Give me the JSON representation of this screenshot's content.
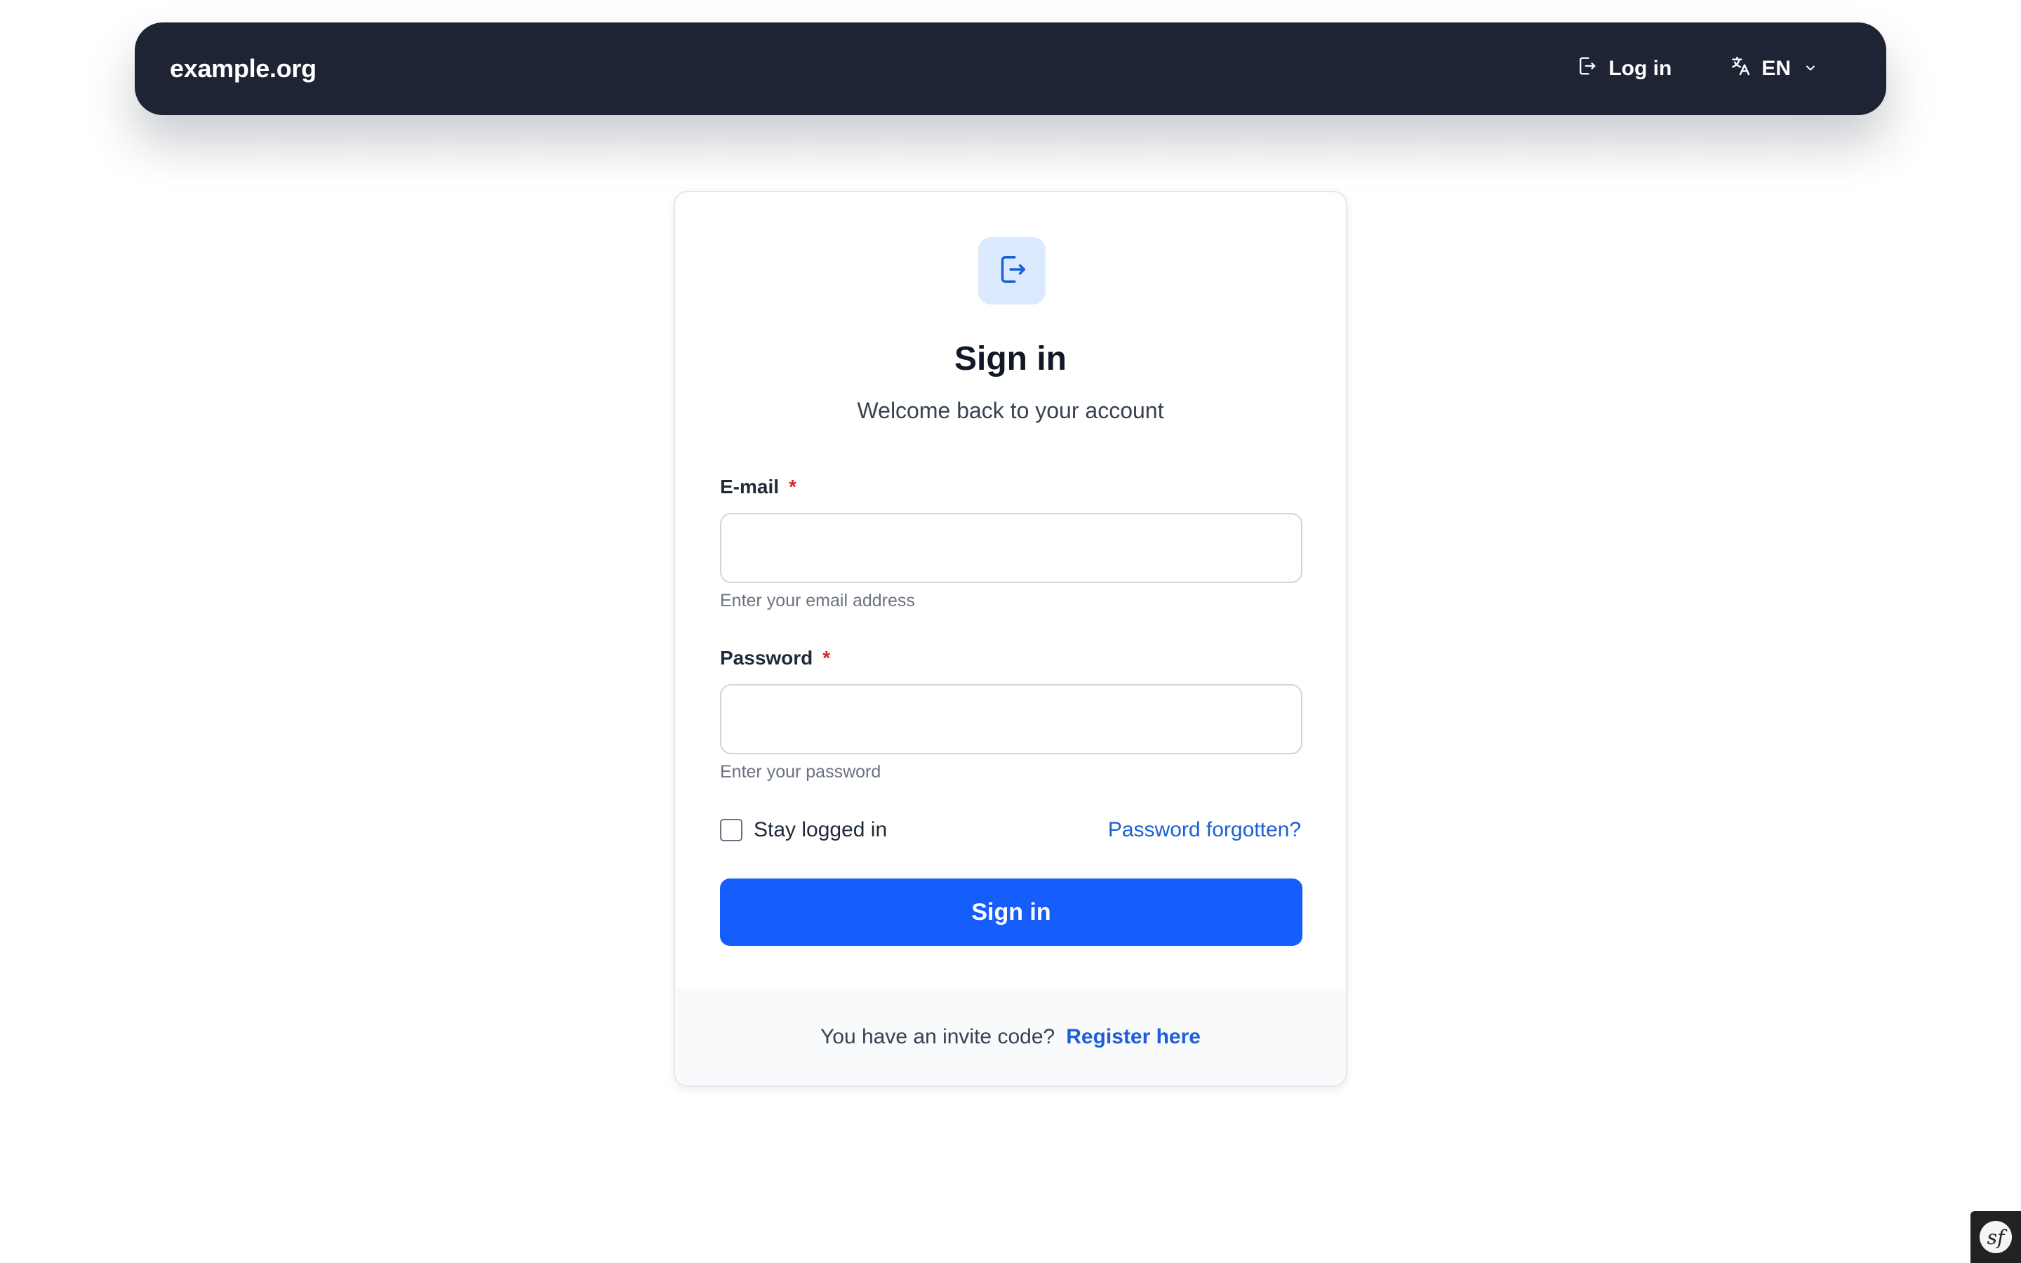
{
  "navbar": {
    "brand": "example.org",
    "login_label": "Log in",
    "language": "EN",
    "background_color": "#1f2435",
    "icons": {
      "login": "login-icon",
      "language": "translate-icon",
      "dropdown": "chevron-down-icon"
    }
  },
  "card": {
    "icon": "login-icon",
    "title": "Sign in",
    "subtitle": "Welcome back to your account",
    "email": {
      "label": "E-mail",
      "required_mark": "*",
      "value": "",
      "hint": "Enter your email address"
    },
    "password": {
      "label": "Password",
      "required_mark": "*",
      "value": "",
      "hint": "Enter your password"
    },
    "remember_label": "Stay logged in",
    "remember_checked": false,
    "forgot_label": "Password forgotten?",
    "submit_label": "Sign in",
    "footer": {
      "text": "You have an invite code?",
      "link_label": "Register here"
    }
  },
  "colors": {
    "accent": "#155efc",
    "link": "#1d5fd6",
    "required": "#dc2626",
    "icon_tile": "#dbeafe"
  },
  "debug_toolbar": {
    "icon": "symfony-logo-icon",
    "glyph": "sf"
  }
}
